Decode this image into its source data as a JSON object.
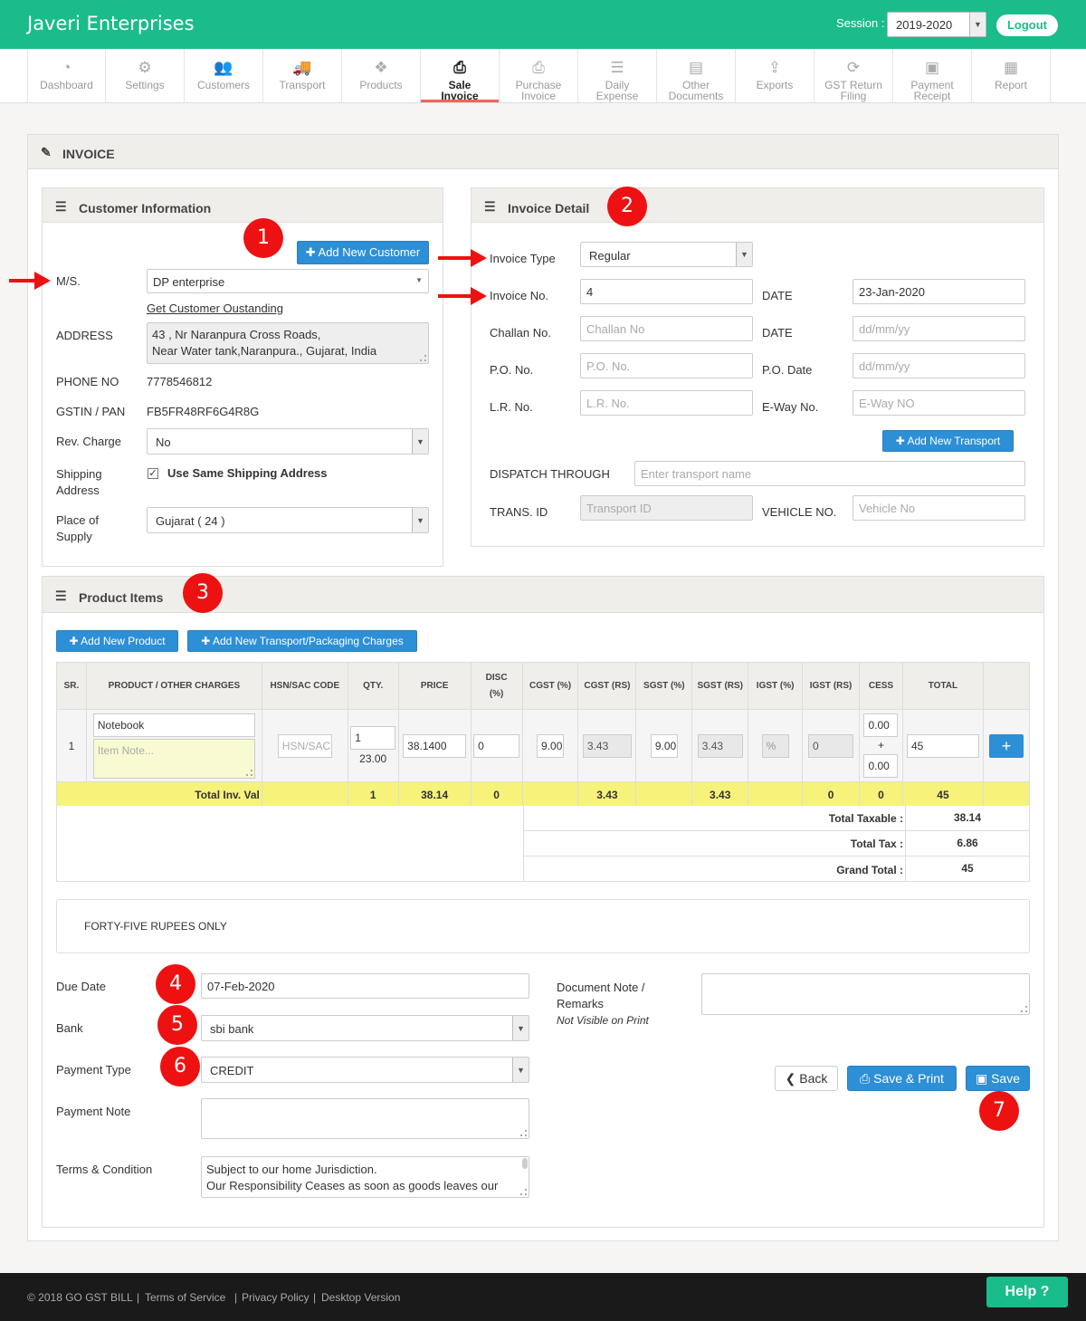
{
  "header": {
    "brand": "Javeri Enterprises",
    "session_label": "Session :",
    "session_value": "2019-2020",
    "logout": "Logout"
  },
  "nav": [
    {
      "label": "Dashboard",
      "icon": "dashboard-icon"
    },
    {
      "label": "Settings",
      "icon": "gear-icon"
    },
    {
      "label": "Customers",
      "icon": "users-icon"
    },
    {
      "label": "Transport",
      "icon": "truck-icon"
    },
    {
      "label": "Products",
      "icon": "cubes-icon"
    },
    {
      "label": "Sale Invoice",
      "icon": "print-icon",
      "active": true
    },
    {
      "label": "Purchase Invoice",
      "icon": "print-icon"
    },
    {
      "label": "Daily Expense",
      "icon": "list-icon"
    },
    {
      "label": "Other Documents",
      "icon": "file-icon"
    },
    {
      "label": "Exports",
      "icon": "upload-icon"
    },
    {
      "label": "GST Return Filing",
      "icon": "refresh-icon"
    },
    {
      "label": "Payment Receipt",
      "icon": "money-icon"
    },
    {
      "label": "Report",
      "icon": "report-icon"
    }
  ],
  "invoice_title": "INVOICE",
  "customer": {
    "title": "Customer Information",
    "add_button": "Add New Customer",
    "ms_label": "M/S.",
    "ms_value": "DP enterprise",
    "outstanding_link": "Get Customer Oustanding",
    "address_label": "ADDRESS",
    "address_line1": "43 , Nr Naranpura Cross Roads,",
    "address_line2": "Near Water tank,Naranpura., Gujarat, India",
    "phone_label": "PHONE NO",
    "phone_value": "7778546812",
    "gstin_label": "GSTIN / PAN",
    "gstin_value": "FB5FR48RF6G4R8G",
    "rev_label": "Rev. Charge",
    "rev_value": "No",
    "shipping_label1": "Shipping",
    "shipping_label2": "Address",
    "same_shipping": "Use Same Shipping Address",
    "pos_label1": "Place of",
    "pos_label2": "Supply",
    "pos_value": "Gujarat ( 24 )"
  },
  "invoice_detail": {
    "title": "Invoice Detail",
    "type_label": "Invoice Type",
    "type_value": "Regular",
    "no_label": "Invoice No.",
    "no_value": "4",
    "date_label": "DATE",
    "date_value": "23-Jan-2020",
    "challan_label": "Challan No.",
    "challan_ph": "Challan No",
    "challan_date_label": "DATE",
    "challan_date_ph": "dd/mm/yy",
    "po_label": "P.O. No.",
    "po_ph": "P.O. No.",
    "po_date_label": "P.O. Date",
    "po_date_ph": "dd/mm/yy",
    "lr_label": "L.R. No.",
    "lr_ph": "L.R. No.",
    "eway_label": "E-Way No.",
    "eway_ph": "E-Way NO",
    "add_transport": "Add New Transport",
    "dispatch_label": "DISPATCH THROUGH",
    "dispatch_ph": "Enter transport name",
    "trans_id_label": "TRANS. ID",
    "trans_id_ph": "Transport ID",
    "vehicle_label": "VEHICLE NO.",
    "vehicle_ph": "Vehicle No"
  },
  "products": {
    "title": "Product Items",
    "add_product": "Add New Product",
    "add_charges": "Add New Transport/Packaging Charges",
    "columns": [
      "SR.",
      "PRODUCT / OTHER CHARGES",
      "HSN/SAC CODE",
      "QTY.",
      "PRICE",
      "DISC",
      "(%)",
      "CGST (%)",
      "CGST (RS)",
      "SGST (%)",
      "SGST (RS)",
      "IGST (%)",
      "IGST (RS)",
      "CESS",
      "TOTAL"
    ],
    "row": {
      "sr": "1",
      "product": "Notebook",
      "note_ph": "Item Note...",
      "hsn_ph": "HSN/SAC",
      "qty": "1",
      "qty_sub": "23.00",
      "price": "38.1400",
      "disc": "0",
      "cgst_pct": "9.00",
      "cgst_rs": "3.43",
      "sgst_pct": "9.00",
      "sgst_rs": "3.43",
      "igst_pct": "%",
      "igst_rs": "0",
      "cess1": "0.00",
      "cess_plus": "+",
      "cess2": "0.00",
      "total": "45"
    },
    "totals_row": {
      "label": "Total Inv. Val",
      "qty": "1",
      "price": "38.14",
      "disc": "0",
      "cgst": "3.43",
      "sgst": "3.43",
      "igst": "0",
      "cess": "0",
      "total": "45"
    },
    "summary": {
      "taxable_label": "Total Taxable :",
      "taxable": "38.14",
      "tax_label": "Total Tax :",
      "tax": "6.86",
      "grand_label": "Grand Total :",
      "grand": "45"
    },
    "in_words": "FORTY-FIVE RUPEES ONLY"
  },
  "bottom": {
    "due_label": "Due Date",
    "due_value": "07-Feb-2020",
    "bank_label": "Bank",
    "bank_value": "sbi bank",
    "ptype_label": "Payment Type",
    "ptype_value": "CREDIT",
    "pnote_label": "Payment Note",
    "terms_label": "Terms & Condition",
    "terms_line1": "Subject to our home Jurisdiction.",
    "terms_line2": "Our Responsibility Ceases as soon as goods leaves our",
    "doc_note_label1": "Document Note /",
    "doc_note_label2": "Remarks",
    "doc_note_sub": "Not Visible on Print",
    "back": "Back",
    "save_print": "Save & Print",
    "save": "Save"
  },
  "badges": [
    "1",
    "2",
    "3",
    "4",
    "5",
    "6",
    "7"
  ],
  "footer": {
    "copyright": "© 2018 GO GST BILL",
    "tos": "Terms of Service",
    "privacy": "Privacy Policy",
    "desktop": "Desktop Version",
    "help": "Help ?"
  },
  "colors": {
    "brand": "#1abc8c",
    "primary_button": "#2d8fd5",
    "annotation": "#e11111",
    "total_row": "#f7f27a"
  }
}
